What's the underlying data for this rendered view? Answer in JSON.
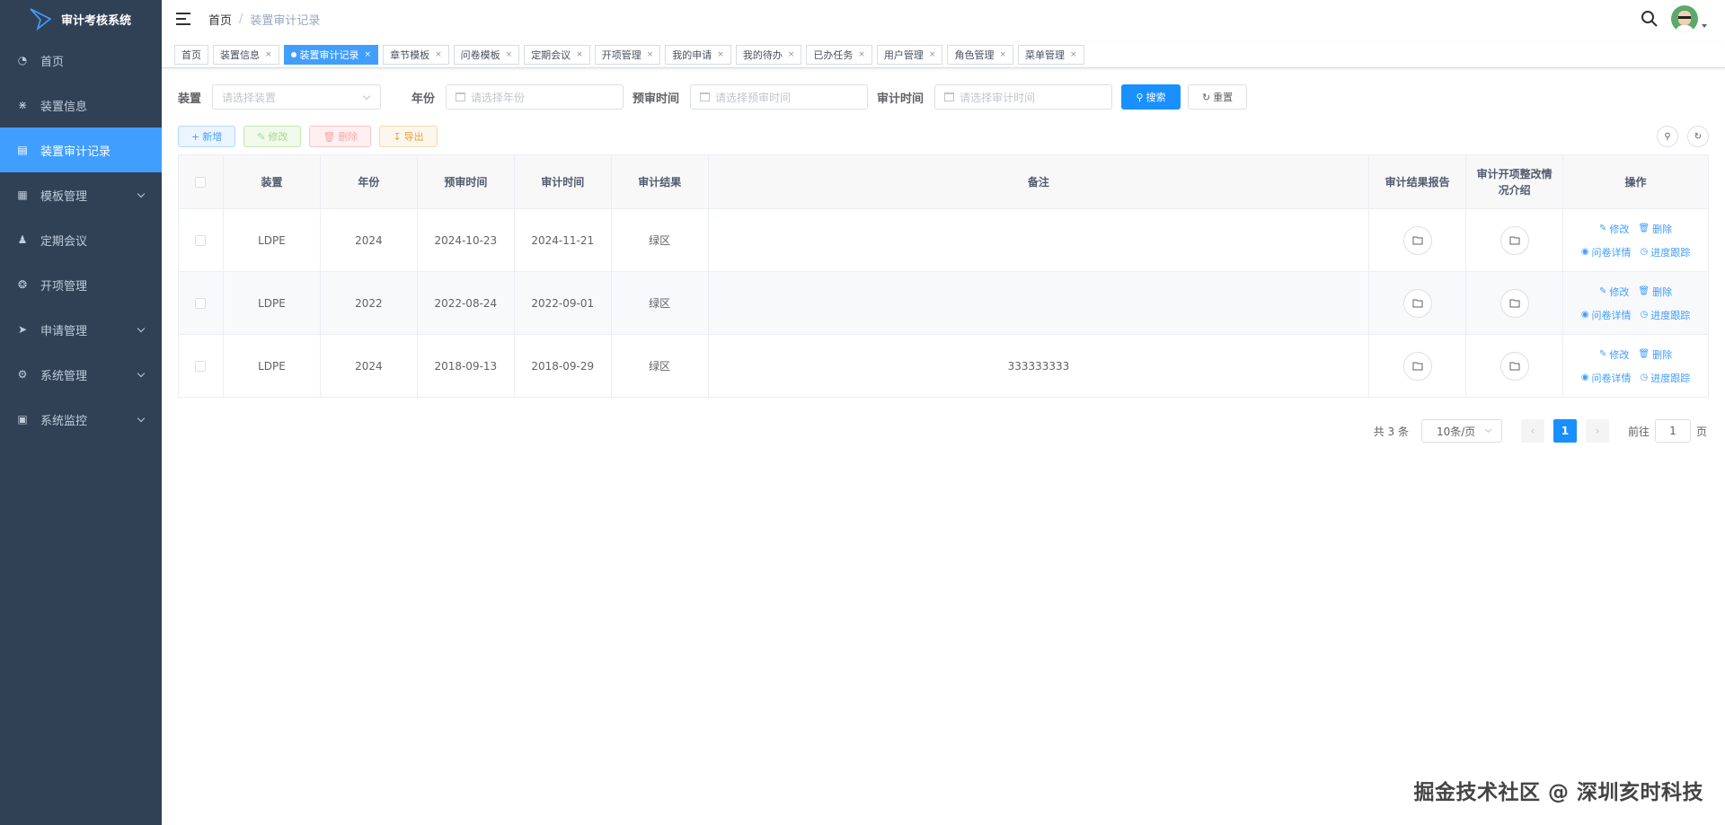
{
  "app": {
    "title": "审计考核系统"
  },
  "sidebar": {
    "items": [
      {
        "label": "首页",
        "icon": "dashboard-icon"
      },
      {
        "label": "装置信息",
        "icon": "tree-icon"
      },
      {
        "label": "装置审计记录",
        "icon": "document-icon",
        "active": true
      },
      {
        "label": "模板管理",
        "icon": "table-icon",
        "expandable": true
      },
      {
        "label": "定期会议",
        "icon": "peoples-icon"
      },
      {
        "label": "开项管理",
        "icon": "example-icon"
      },
      {
        "label": "申请管理",
        "icon": "send-icon",
        "expandable": true
      },
      {
        "label": "系统管理",
        "icon": "gear-icon",
        "expandable": true
      },
      {
        "label": "系统监控",
        "icon": "monitor-icon",
        "expandable": true
      }
    ]
  },
  "header": {
    "breadcrumb": {
      "home": "首页",
      "separator": "/",
      "current": "装置审计记录"
    }
  },
  "tags": [
    {
      "label": "首页",
      "closable": false
    },
    {
      "label": "装置信息",
      "closable": true
    },
    {
      "label": "装置审计记录",
      "closable": true,
      "active": true
    },
    {
      "label": "章节模板",
      "closable": true
    },
    {
      "label": "问卷模板",
      "closable": true
    },
    {
      "label": "定期会议",
      "closable": true
    },
    {
      "label": "开项管理",
      "closable": true
    },
    {
      "label": "我的申请",
      "closable": true
    },
    {
      "label": "我的待办",
      "closable": true
    },
    {
      "label": "已办任务",
      "closable": true
    },
    {
      "label": "用户管理",
      "closable": true
    },
    {
      "label": "角色管理",
      "closable": true
    },
    {
      "label": "菜单管理",
      "closable": true
    }
  ],
  "search": {
    "device_label": "装置",
    "device_placeholder": "请选择装置",
    "year_label": "年份",
    "year_placeholder": "请选择年份",
    "pre_label": "预审时间",
    "pre_placeholder": "请选择预审时间",
    "audit_label": "审计时间",
    "audit_placeholder": "请选择审计时间",
    "search_button": "搜索",
    "reset_button": "重置"
  },
  "toolbar": {
    "add": "新增",
    "edit": "修改",
    "delete": "删除",
    "export": "导出"
  },
  "table": {
    "columns": [
      "装置",
      "年份",
      "预审时间",
      "审计时间",
      "审计结果",
      "备注",
      "审计结果报告",
      "审计开项整改情况介绍",
      "操作"
    ],
    "rows": [
      {
        "device": "LDPE",
        "year": "2024",
        "pre_time": "2024-10-23",
        "audit_time": "2024-11-21",
        "result": "绿区",
        "remark": ""
      },
      {
        "device": "LDPE",
        "year": "2022",
        "pre_time": "2022-08-24",
        "audit_time": "2022-09-01",
        "result": "绿区",
        "remark": ""
      },
      {
        "device": "LDPE",
        "year": "2024",
        "pre_time": "2018-09-13",
        "audit_time": "2018-09-29",
        "result": "绿区",
        "remark": "333333333"
      }
    ],
    "actions": {
      "edit": "修改",
      "delete": "删除",
      "detail": "问卷详情",
      "track": "进度跟踪"
    }
  },
  "pagination": {
    "total": "共 3 条",
    "page_size": "10条/页",
    "current": "1",
    "goto_prefix": "前往",
    "goto_value": "1",
    "goto_suffix": "页"
  },
  "watermark": "掘金技术社区 @ 深圳亥时科技",
  "colors": {
    "sidebar_bg": "#304156",
    "primary": "#409eff",
    "search_button": "#1890ff"
  }
}
